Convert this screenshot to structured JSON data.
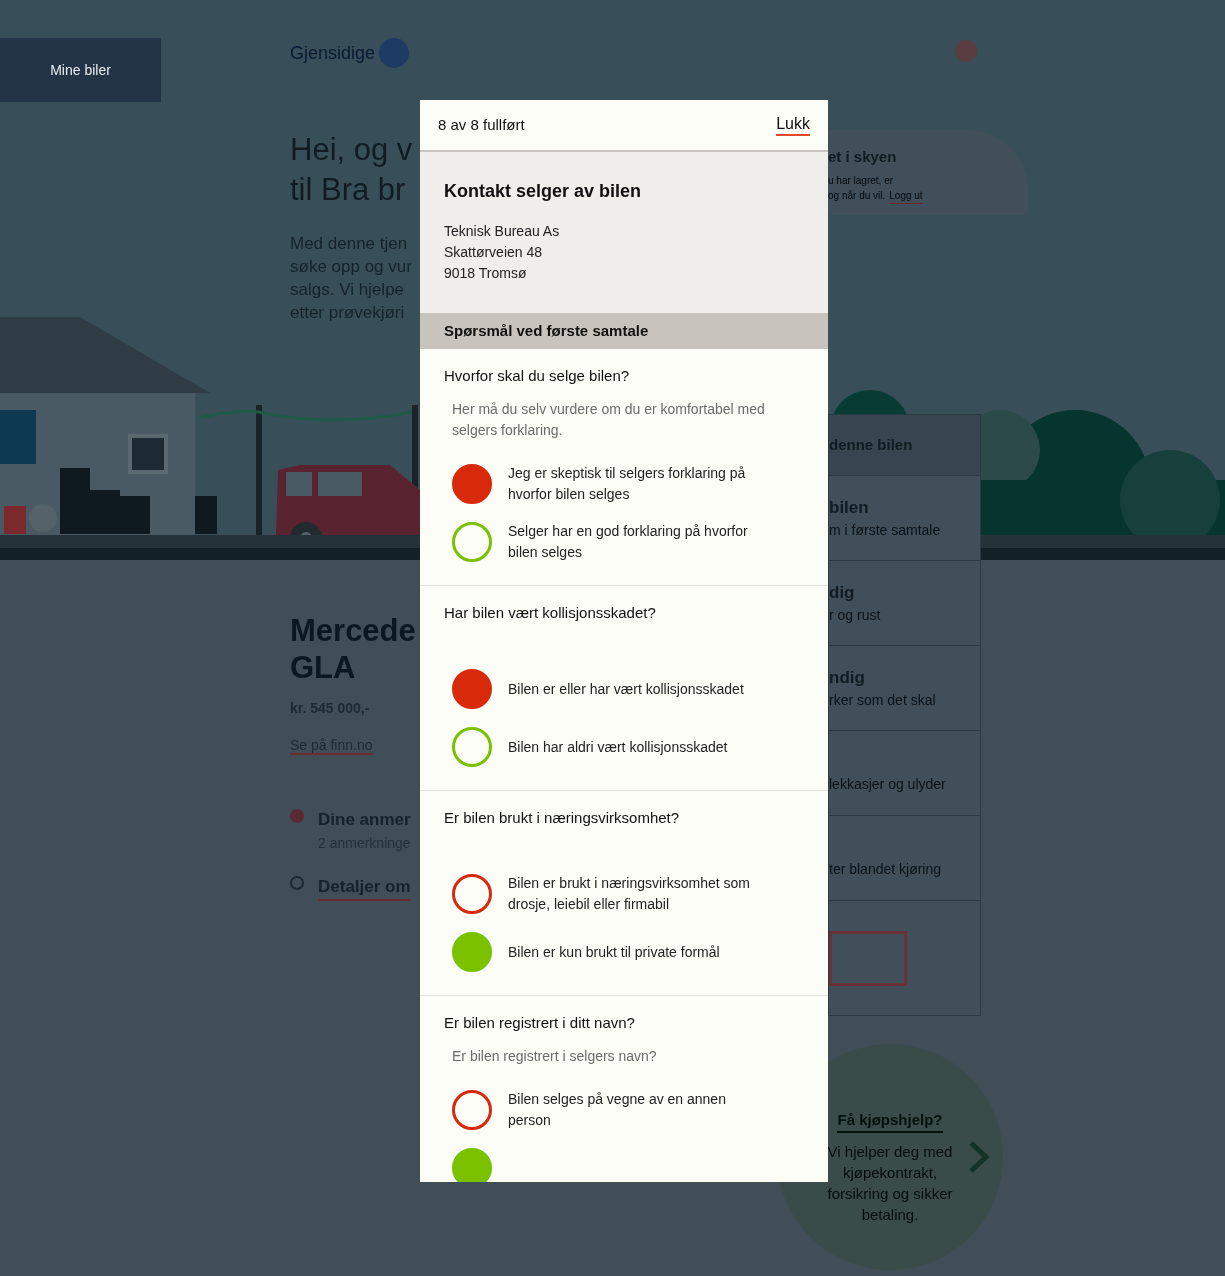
{
  "nav": {
    "button": "Mine biler"
  },
  "logo": {
    "text": "Gjensidige"
  },
  "hero": {
    "title_lines": [
      "Hei, og v",
      "til Bra br"
    ],
    "body_lines": [
      "Med denne tjen",
      "søke opp og vur",
      "salgs. Vi hjelpe",
      "etter prøvekjøri"
    ]
  },
  "cloud_notice": {
    "title": "et i skyen",
    "lines": [
      "u har lagret, er",
      "og når du vil."
    ],
    "link": "Logg ut"
  },
  "car": {
    "title_lines": [
      "Mercede",
      "GLA"
    ],
    "price": "kr. 545 000,-",
    "link": "Se på finn.no"
  },
  "car_links": [
    {
      "kind": "dot",
      "title": "Dine anmer",
      "subtitle": "2 anmerkninge",
      "color": "#5a2a33"
    },
    {
      "kind": "wheel",
      "title": "Detaljer om"
    }
  ],
  "checklist": {
    "header": "denne bilen",
    "rows": [
      {
        "title": "bilen",
        "subtitle": "m i første samtale"
      },
      {
        "title": "dig",
        "subtitle": "r og rust"
      },
      {
        "title": "ndig",
        "subtitle": "rker som det skal"
      },
      {
        "subtitle": "lekkasjer og ulyder"
      },
      {
        "subtitle": "ter blandet kjøring"
      }
    ]
  },
  "help": {
    "title": "Få kjøpshjelp?",
    "text": "Vi hjelper deg med kjøpekontrakt, forsikring og sikker betaling."
  },
  "modal": {
    "progress": "8 av 8 fullført",
    "close": "Lukk",
    "contact": {
      "title": "Kontakt selger av bilen",
      "lines": [
        "Teknisk Bureau As",
        "Skattørveien 48",
        "9018 Tromsø"
      ]
    },
    "section": "Spørsmål ved første samtale",
    "questions": [
      {
        "title": "Hvorfor skal du selge bilen?",
        "hint": "Her må du selv vurdere om du er komfortabel med selgers forklaring.",
        "options": [
          {
            "label": "Jeg er skeptisk til selgers forklaring på hvorfor bilen selges",
            "color": "#d9290b",
            "selected": true
          },
          {
            "label": "Selger har en god forklaring på hvorfor bilen selges",
            "color": "#7ac100",
            "selected": false
          }
        ]
      },
      {
        "title": "Har bilen vært kollisjonsskadet?",
        "options": [
          {
            "label": "Bilen er eller har vært kollisjonsskadet",
            "color": "#d9290b",
            "selected": true
          },
          {
            "label": "Bilen har aldri vært kollisjonsskadet",
            "color": "#7ac100",
            "selected": false
          }
        ]
      },
      {
        "title": "Er bilen brukt i næringsvirksomhet?",
        "options": [
          {
            "label": "Bilen er brukt i næringsvirksomhet som drosje, leiebil eller firmabil",
            "color": "#d9290b",
            "selected": false
          },
          {
            "label": "Bilen er kun brukt til private formål",
            "color": "#7ac100",
            "selected": true
          }
        ]
      },
      {
        "title": "Er bilen registrert i ditt navn?",
        "hint": "Er bilen registrert i selgers navn?",
        "options": [
          {
            "label": "Bilen selges på vegne av en annen person",
            "color": "#d9290b",
            "selected": false
          },
          {
            "color": "#7ac100",
            "selected": true
          }
        ]
      }
    ]
  }
}
